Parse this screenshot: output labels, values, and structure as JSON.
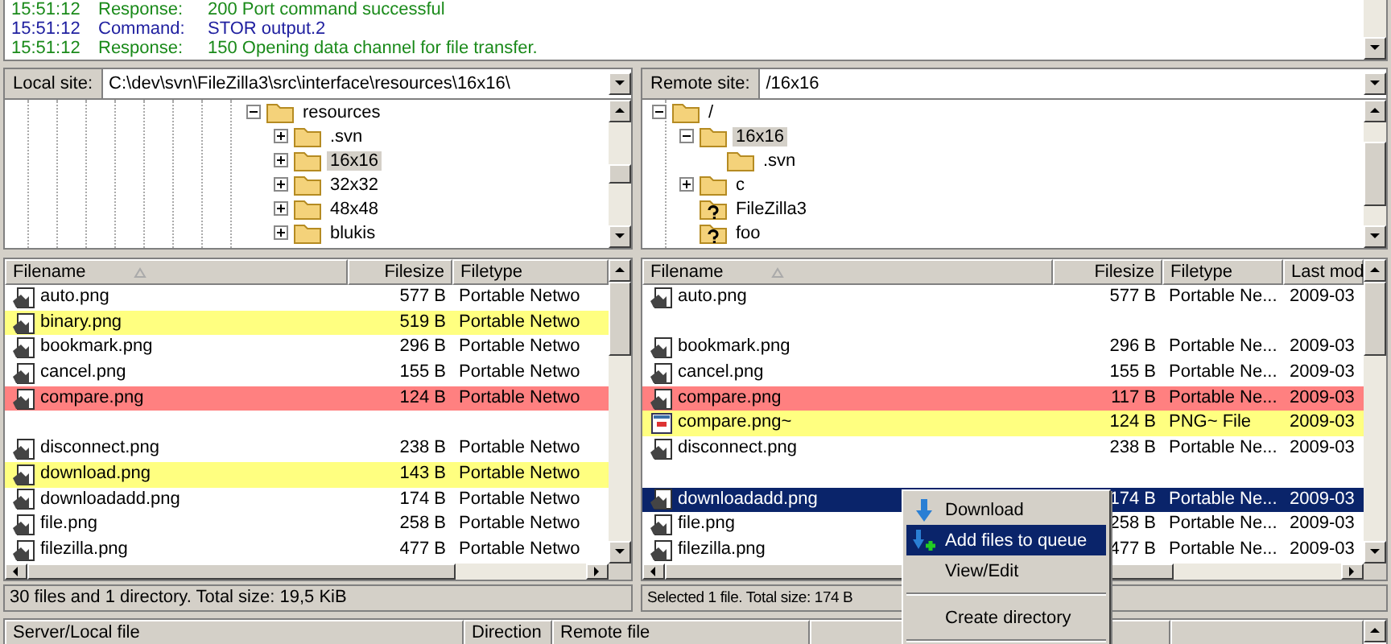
{
  "log": [
    {
      "time": "15:51:12",
      "type": "Response:",
      "message": "200 Port command successful",
      "kind": "response"
    },
    {
      "time": "15:51:12",
      "type": "Command:",
      "message": "STOR output.2",
      "kind": "command"
    },
    {
      "time": "15:51:12",
      "type": "Response:",
      "message": "150 Opening data channel for file transfer.",
      "kind": "response"
    }
  ],
  "local": {
    "site_label": "Local site:",
    "path": "C:\\dev\\svn\\FileZilla3\\src\\interface\\resources\\16x16\\",
    "tree": [
      {
        "name": "resources",
        "kind": "folder",
        "expanded": true,
        "selected": false,
        "expandable": true,
        "children": [
          {
            "name": ".svn",
            "kind": "folder",
            "expanded": false,
            "selected": false,
            "expandable": true
          },
          {
            "name": "16x16",
            "kind": "folder",
            "expanded": false,
            "selected": true,
            "expandable": true
          },
          {
            "name": "32x32",
            "kind": "folder",
            "expanded": false,
            "selected": false,
            "expandable": true
          },
          {
            "name": "48x48",
            "kind": "folder",
            "expanded": false,
            "selected": false,
            "expandable": true
          },
          {
            "name": "blukis",
            "kind": "folder",
            "expanded": false,
            "selected": false,
            "expandable": true
          }
        ]
      }
    ],
    "columns": [
      "Filename",
      "Filesize",
      "Filetype"
    ],
    "rows": [
      {
        "kind": "image",
        "name": "auto.png",
        "size": "577 B",
        "type": "Portable Netwo",
        "color": "#ffffff",
        "selected": false
      },
      {
        "kind": "image",
        "name": "binary.png",
        "size": "519 B",
        "type": "Portable Netwo",
        "color": "#ffff80",
        "selected": false
      },
      {
        "kind": "image",
        "name": "bookmark.png",
        "size": "296 B",
        "type": "Portable Netwo",
        "color": "#ffffff",
        "selected": false
      },
      {
        "kind": "image",
        "name": "cancel.png",
        "size": "155 B",
        "type": "Portable Netwo",
        "color": "#ffffff",
        "selected": false
      },
      {
        "kind": "image",
        "name": "compare.png",
        "size": "124 B",
        "type": "Portable Netwo",
        "color": "#ff8080",
        "selected": false
      },
      {
        "kind": "empty",
        "color": "#ffffff",
        "selected": false
      },
      {
        "kind": "image",
        "name": "disconnect.png",
        "size": "238 B",
        "type": "Portable Netwo",
        "color": "#ffffff",
        "selected": false
      },
      {
        "kind": "image",
        "name": "download.png",
        "size": "143 B",
        "type": "Portable Netwo",
        "color": "#ffff80",
        "selected": false
      },
      {
        "kind": "image",
        "name": "downloadadd.png",
        "size": "174 B",
        "type": "Portable Netwo",
        "color": "#ffffff",
        "selected": false
      },
      {
        "kind": "image",
        "name": "file.png",
        "size": "258 B",
        "type": "Portable Netwo",
        "color": "#ffffff",
        "selected": false
      },
      {
        "kind": "image",
        "name": "filezilla.png",
        "size": "477 B",
        "type": "Portable Netwo",
        "color": "#ffffff",
        "selected": false
      }
    ],
    "status": "30 files and 1 directory. Total size: 19,5 KiB"
  },
  "remote": {
    "site_label": "Remote site:",
    "path": "/16x16",
    "tree": [
      {
        "name": "/",
        "kind": "folder",
        "expanded": true,
        "selected": false,
        "expandable": true,
        "children": [
          {
            "name": "16x16",
            "kind": "folder",
            "expanded": true,
            "selected": true,
            "expandable": true,
            "children": [
              {
                "name": ".svn",
                "kind": "folder",
                "selected": false,
                "expandable": false
              }
            ]
          },
          {
            "name": "c",
            "kind": "folder",
            "expanded": false,
            "selected": false,
            "expandable": true
          },
          {
            "name": "FileZilla3",
            "kind": "unknown",
            "selected": false,
            "expandable": false
          },
          {
            "name": "foo",
            "kind": "unknown",
            "selected": false,
            "expandable": false
          }
        ]
      }
    ],
    "columns": [
      "Filename",
      "Filesize",
      "Filetype",
      "Last mod"
    ],
    "rows": [
      {
        "kind": "image",
        "name": "auto.png",
        "size": "577 B",
        "type": "Portable Ne...",
        "modified": "2009-03",
        "color": "#ffffff",
        "selected": false
      },
      {
        "kind": "empty",
        "color": "#ffffff",
        "selected": false
      },
      {
        "kind": "image",
        "name": "bookmark.png",
        "size": "296 B",
        "type": "Portable Ne...",
        "modified": "2009-03",
        "color": "#ffffff",
        "selected": false
      },
      {
        "kind": "image",
        "name": "cancel.png",
        "size": "155 B",
        "type": "Portable Ne...",
        "modified": "2009-03",
        "color": "#ffffff",
        "selected": false
      },
      {
        "kind": "image",
        "name": "compare.png",
        "size": "117 B",
        "type": "Portable Ne...",
        "modified": "2009-03",
        "color": "#ff8080",
        "selected": false
      },
      {
        "kind": "other",
        "name": "compare.png~",
        "size": "124 B",
        "type": "PNG~ File",
        "modified": "2009-03",
        "color": "#ffff80",
        "selected": false
      },
      {
        "kind": "image",
        "name": "disconnect.png",
        "size": "238 B",
        "type": "Portable Ne...",
        "modified": "2009-03",
        "color": "#ffffff",
        "selected": false
      },
      {
        "kind": "empty",
        "color": "#ffffff",
        "selected": false
      },
      {
        "kind": "image",
        "name": "downloadadd.png",
        "size": "174 B",
        "type": "Portable Ne...",
        "modified": "2009-03",
        "selected": true
      },
      {
        "kind": "image",
        "name": "file.png",
        "size": "258 B",
        "type": "Portable Ne...",
        "modified": "2009-03",
        "color": "#ffffff",
        "selected": false
      },
      {
        "kind": "image",
        "name": "filezilla.png",
        "size": "477 B",
        "type": "Portable Ne...",
        "modified": "2009-03",
        "color": "#ffffff",
        "selected": false
      }
    ],
    "status": "Selected 1 file. Total size: 174 B"
  },
  "queue": {
    "columns": [
      "Server/Local file",
      "Direction",
      "Remote file"
    ]
  },
  "context_menu": [
    {
      "kind": "item",
      "label": "Download",
      "selected": false
    },
    {
      "kind": "item",
      "label": "Add files to queue",
      "selected": true
    },
    {
      "kind": "item",
      "label": "View/Edit",
      "selected": false
    },
    {
      "kind": "separator"
    },
    {
      "kind": "item",
      "label": "Create directory",
      "selected": false
    },
    {
      "kind": "separator"
    }
  ]
}
